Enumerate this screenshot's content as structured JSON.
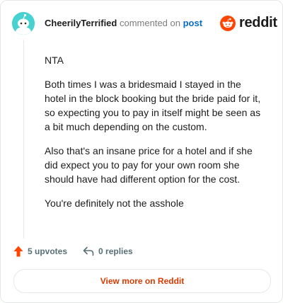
{
  "comment": {
    "username": "CheerilyTerrified",
    "commented_on": "commented on",
    "post_link": "post",
    "paragraphs": [
      "NTA",
      "Both times I was a bridesmaid I stayed in the hotel in the block booking but the bride paid for it, so expecting you to pay in itself might be seen as a bit much depending on the custom.",
      "Also that's an insane price for a hotel and if she did expect you to pay for your own room she should have had different option for the cost.",
      "You're definitely not the asshole"
    ]
  },
  "brand": {
    "wordmark": "reddit",
    "color": "#ff4500"
  },
  "actions": {
    "upvotes": "5 upvotes",
    "replies": "0 replies",
    "upvote_color": "#ff4500"
  },
  "cta": {
    "label": "View more on Reddit",
    "color": "#d93a00"
  },
  "icons": [
    "avatar-icon",
    "reddit-logo-icon",
    "upvote-arrow-icon",
    "reply-icon"
  ]
}
